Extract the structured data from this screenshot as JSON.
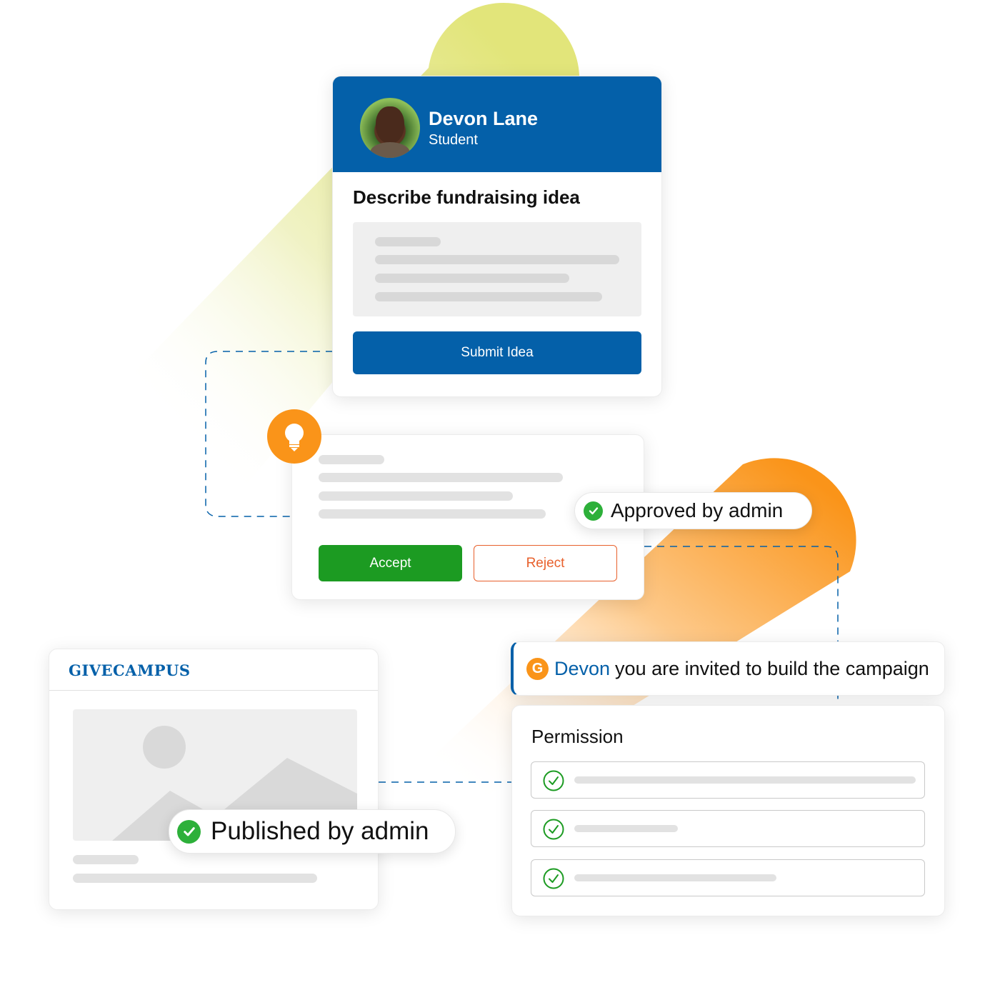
{
  "colors": {
    "brand_blue": "#0460A9",
    "accept_green": "#1C9B22",
    "reject_orange": "#E8602C",
    "accent_orange": "#FA9419",
    "check_green": "#2DB03A",
    "lime": "#E4E67A"
  },
  "idea_form": {
    "user": {
      "name": "Devon Lane",
      "role": "Student",
      "avatar": "avatar-photo"
    },
    "title": "Describe fundraising idea",
    "submit_label": "Submit Idea"
  },
  "review_card": {
    "icon": "lightbulb-icon",
    "accept_label": "Accept",
    "reject_label": "Reject",
    "status_badge": "Approved by admin"
  },
  "campaign_page": {
    "logo": "GIVECAMPUS",
    "status_badge": "Published by admin"
  },
  "invite": {
    "icon_letter": "G",
    "name": "Devon",
    "message": "you are invited to build the campaign"
  },
  "permission": {
    "title": "Permission",
    "items": [
      {
        "checked": true
      },
      {
        "checked": true
      },
      {
        "checked": true
      }
    ]
  }
}
